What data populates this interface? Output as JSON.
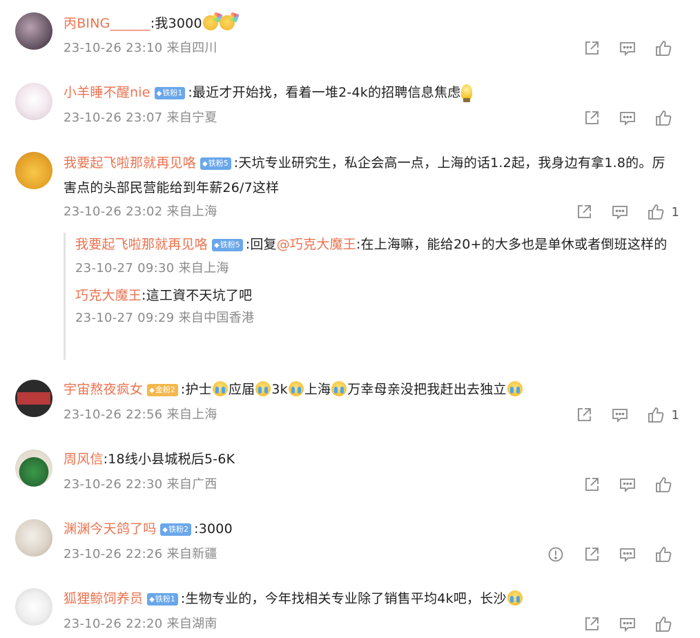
{
  "comments": [
    {
      "username": "丙BING______",
      "badge": "",
      "text_parts": [
        ":我3000"
      ],
      "time": "23-10-26 23:10",
      "location": "来自四川",
      "likes": ""
    },
    {
      "username": "小羊睡不醒nie",
      "badge": "铁粉1",
      "text_parts": [
        ":最近才开始找，看着一堆2-4k的招聘信息焦虑"
      ],
      "time": "23-10-26 23:07",
      "location": "来自宁夏",
      "likes": ""
    },
    {
      "username": "我要起飞啦那就再见咯",
      "badge": "铁粉5",
      "text_parts": [
        ":天坑专业研究生，私企会高一点，上海的话1.2起，我身边有拿1.8的。厉害点的头部民营能给到年薪26/7这样"
      ],
      "time": "23-10-26 23:02",
      "location": "来自上海",
      "likes": "1",
      "replies": [
        {
          "username": "我要起飞啦那就再见咯",
          "badge": "铁粉5",
          "prefix": ":回复",
          "mention": "@巧克大魔王",
          "text": ":在上海嘛，能给20+的大多也是单休或者倒班这样的",
          "time": "23-10-27 09:30",
          "location": "来自上海"
        },
        {
          "username": "巧克大魔王",
          "badge": "",
          "prefix": "",
          "mention": "",
          "text": ":這工資不天坑了吧",
          "time": "23-10-27 09:29",
          "location": "来自中国香港"
        }
      ]
    },
    {
      "username": "宇宙熬夜疯女",
      "badge": "金粉2",
      "text_parts": [
        ":护士",
        "应届",
        "3k",
        "上海",
        "万幸母亲没把我赶出去独立"
      ],
      "time": "23-10-26 22:56",
      "location": "来自上海",
      "likes": "1"
    },
    {
      "username": "周风信",
      "badge": "",
      "text_parts": [
        ":18线小县城税后5-6K"
      ],
      "time": "23-10-26 22:30",
      "location": "来自广西",
      "likes": ""
    },
    {
      "username": "渊渊今天鸽了吗",
      "badge": "铁粉2",
      "text_parts": [
        ":3000"
      ],
      "time": "23-10-26 22:26",
      "location": "来自新疆",
      "likes": ""
    },
    {
      "username": "狐狸鲸饲养员",
      "badge": "铁粉1",
      "text_parts": [
        ":生物专业的，今年找相关专业除了销售平均4k吧，长沙"
      ],
      "time": "23-10-26 22:20",
      "location": "来自湖南",
      "likes": ""
    }
  ],
  "icons": {
    "share": "share-icon",
    "comment": "comment-icon",
    "like": "like-icon",
    "report": "report-icon"
  },
  "colors": {
    "username": "#eb7350",
    "meta": "#8a8a8a",
    "badge_iron": "#6aa7ea",
    "badge_gold": "#f3b84d"
  }
}
